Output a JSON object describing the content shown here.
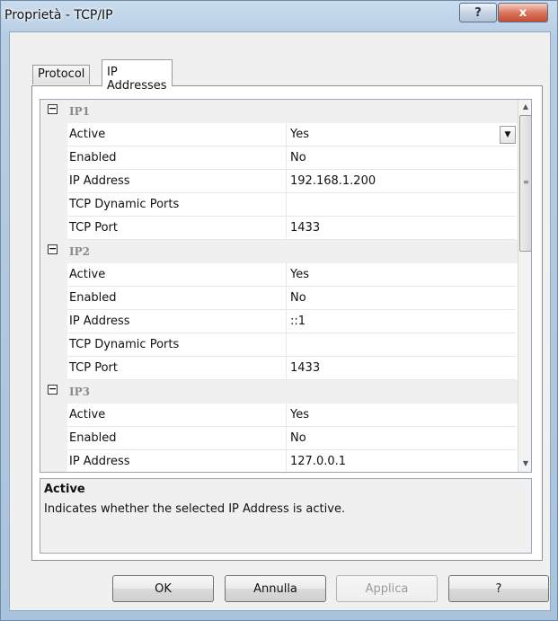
{
  "window": {
    "title": "Proprietà - TCP/IP",
    "help_button": "?",
    "close_button": "x"
  },
  "tabs": [
    {
      "label": "Protocol",
      "active": false
    },
    {
      "label": "IP Addresses",
      "active": true
    }
  ],
  "grid": {
    "categories": [
      {
        "name": "IP1",
        "expander": "⊟",
        "rows": [
          {
            "label": "Active",
            "value": "Yes"
          },
          {
            "label": "Enabled",
            "value": "No"
          },
          {
            "label": "IP Address",
            "value": "192.168.1.200"
          },
          {
            "label": "TCP Dynamic Ports",
            "value": ""
          },
          {
            "label": "TCP Port",
            "value": "1433"
          }
        ]
      },
      {
        "name": "IP2",
        "expander": "⊟",
        "rows": [
          {
            "label": "Active",
            "value": "Yes"
          },
          {
            "label": "Enabled",
            "value": "No"
          },
          {
            "label": "IP Address",
            "value": "::1"
          },
          {
            "label": "TCP Dynamic Ports",
            "value": ""
          },
          {
            "label": "TCP Port",
            "value": "1433"
          }
        ]
      },
      {
        "name": "IP3",
        "expander": "⊟",
        "rows": [
          {
            "label": "Active",
            "value": "Yes"
          },
          {
            "label": "Enabled",
            "value": "No"
          },
          {
            "label": "IP Address",
            "value": "127.0.0.1"
          }
        ]
      }
    ],
    "selected_row": "IP1.Active"
  },
  "description": {
    "title": "Active",
    "text": "Indicates whether the selected IP Address is active."
  },
  "buttons": {
    "ok": "OK",
    "cancel": "Annulla",
    "apply": "Applica",
    "help": "?"
  },
  "icons": {
    "dropdown": "chevron-down-icon",
    "scroll_up": "scroll-up-arrow-icon",
    "scroll_down": "scroll-down-arrow-icon"
  }
}
